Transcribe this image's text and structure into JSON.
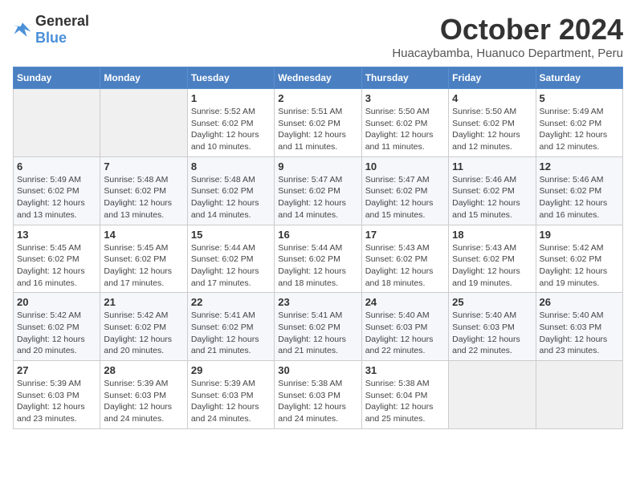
{
  "logo": {
    "general": "General",
    "blue": "Blue"
  },
  "title": "October 2024",
  "location": "Huacaybamba, Huanuco Department, Peru",
  "weekdays": [
    "Sunday",
    "Monday",
    "Tuesday",
    "Wednesday",
    "Thursday",
    "Friday",
    "Saturday"
  ],
  "weeks": [
    [
      {
        "day": "",
        "info": ""
      },
      {
        "day": "",
        "info": ""
      },
      {
        "day": "1",
        "info": "Sunrise: 5:52 AM\nSunset: 6:02 PM\nDaylight: 12 hours\nand 10 minutes."
      },
      {
        "day": "2",
        "info": "Sunrise: 5:51 AM\nSunset: 6:02 PM\nDaylight: 12 hours\nand 11 minutes."
      },
      {
        "day": "3",
        "info": "Sunrise: 5:50 AM\nSunset: 6:02 PM\nDaylight: 12 hours\nand 11 minutes."
      },
      {
        "day": "4",
        "info": "Sunrise: 5:50 AM\nSunset: 6:02 PM\nDaylight: 12 hours\nand 12 minutes."
      },
      {
        "day": "5",
        "info": "Sunrise: 5:49 AM\nSunset: 6:02 PM\nDaylight: 12 hours\nand 12 minutes."
      }
    ],
    [
      {
        "day": "6",
        "info": "Sunrise: 5:49 AM\nSunset: 6:02 PM\nDaylight: 12 hours\nand 13 minutes."
      },
      {
        "day": "7",
        "info": "Sunrise: 5:48 AM\nSunset: 6:02 PM\nDaylight: 12 hours\nand 13 minutes."
      },
      {
        "day": "8",
        "info": "Sunrise: 5:48 AM\nSunset: 6:02 PM\nDaylight: 12 hours\nand 14 minutes."
      },
      {
        "day": "9",
        "info": "Sunrise: 5:47 AM\nSunset: 6:02 PM\nDaylight: 12 hours\nand 14 minutes."
      },
      {
        "day": "10",
        "info": "Sunrise: 5:47 AM\nSunset: 6:02 PM\nDaylight: 12 hours\nand 15 minutes."
      },
      {
        "day": "11",
        "info": "Sunrise: 5:46 AM\nSunset: 6:02 PM\nDaylight: 12 hours\nand 15 minutes."
      },
      {
        "day": "12",
        "info": "Sunrise: 5:46 AM\nSunset: 6:02 PM\nDaylight: 12 hours\nand 16 minutes."
      }
    ],
    [
      {
        "day": "13",
        "info": "Sunrise: 5:45 AM\nSunset: 6:02 PM\nDaylight: 12 hours\nand 16 minutes."
      },
      {
        "day": "14",
        "info": "Sunrise: 5:45 AM\nSunset: 6:02 PM\nDaylight: 12 hours\nand 17 minutes."
      },
      {
        "day": "15",
        "info": "Sunrise: 5:44 AM\nSunset: 6:02 PM\nDaylight: 12 hours\nand 17 minutes."
      },
      {
        "day": "16",
        "info": "Sunrise: 5:44 AM\nSunset: 6:02 PM\nDaylight: 12 hours\nand 18 minutes."
      },
      {
        "day": "17",
        "info": "Sunrise: 5:43 AM\nSunset: 6:02 PM\nDaylight: 12 hours\nand 18 minutes."
      },
      {
        "day": "18",
        "info": "Sunrise: 5:43 AM\nSunset: 6:02 PM\nDaylight: 12 hours\nand 19 minutes."
      },
      {
        "day": "19",
        "info": "Sunrise: 5:42 AM\nSunset: 6:02 PM\nDaylight: 12 hours\nand 19 minutes."
      }
    ],
    [
      {
        "day": "20",
        "info": "Sunrise: 5:42 AM\nSunset: 6:02 PM\nDaylight: 12 hours\nand 20 minutes."
      },
      {
        "day": "21",
        "info": "Sunrise: 5:42 AM\nSunset: 6:02 PM\nDaylight: 12 hours\nand 20 minutes."
      },
      {
        "day": "22",
        "info": "Sunrise: 5:41 AM\nSunset: 6:02 PM\nDaylight: 12 hours\nand 21 minutes."
      },
      {
        "day": "23",
        "info": "Sunrise: 5:41 AM\nSunset: 6:02 PM\nDaylight: 12 hours\nand 21 minutes."
      },
      {
        "day": "24",
        "info": "Sunrise: 5:40 AM\nSunset: 6:03 PM\nDaylight: 12 hours\nand 22 minutes."
      },
      {
        "day": "25",
        "info": "Sunrise: 5:40 AM\nSunset: 6:03 PM\nDaylight: 12 hours\nand 22 minutes."
      },
      {
        "day": "26",
        "info": "Sunrise: 5:40 AM\nSunset: 6:03 PM\nDaylight: 12 hours\nand 23 minutes."
      }
    ],
    [
      {
        "day": "27",
        "info": "Sunrise: 5:39 AM\nSunset: 6:03 PM\nDaylight: 12 hours\nand 23 minutes."
      },
      {
        "day": "28",
        "info": "Sunrise: 5:39 AM\nSunset: 6:03 PM\nDaylight: 12 hours\nand 24 minutes."
      },
      {
        "day": "29",
        "info": "Sunrise: 5:39 AM\nSunset: 6:03 PM\nDaylight: 12 hours\nand 24 minutes."
      },
      {
        "day": "30",
        "info": "Sunrise: 5:38 AM\nSunset: 6:03 PM\nDaylight: 12 hours\nand 24 minutes."
      },
      {
        "day": "31",
        "info": "Sunrise: 5:38 AM\nSunset: 6:04 PM\nDaylight: 12 hours\nand 25 minutes."
      },
      {
        "day": "",
        "info": ""
      },
      {
        "day": "",
        "info": ""
      }
    ]
  ]
}
